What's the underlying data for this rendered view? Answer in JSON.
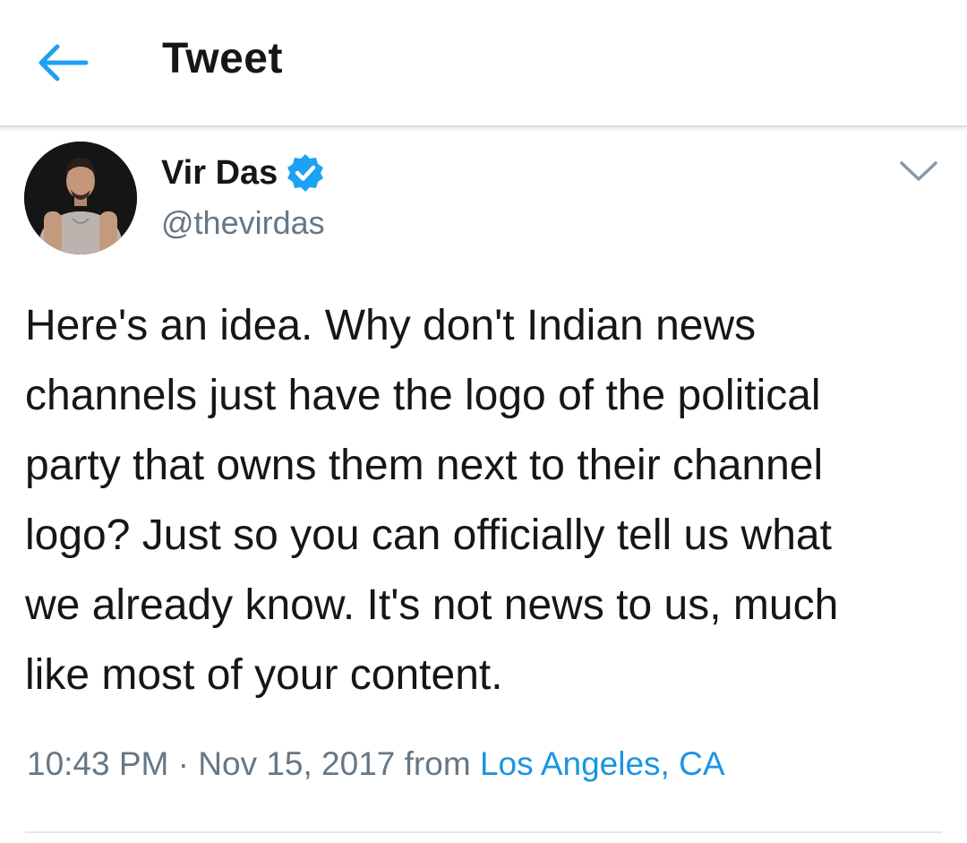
{
  "header": {
    "title": "Tweet",
    "back_icon": "arrow-left-icon"
  },
  "author": {
    "display_name": "Vir Das",
    "handle": "@thevirdas",
    "verified": true,
    "verified_icon": "verified-badge-icon",
    "menu_icon": "chevron-down-icon"
  },
  "tweet": {
    "text": "Here's an idea. Why don't Indian news\nchannels just have the logo of the political\nparty that owns them next to their channel\nlogo? Just so you can officially tell us what\nwe already know. It's not news to us, much\nlike most of your content.",
    "time": "10:43 PM",
    "separator": "·",
    "date": "Nov 15, 2017",
    "from_label": "from",
    "location": "Los Angeles, CA"
  },
  "colors": {
    "accent": "#1da1f2",
    "link": "#1b95e0",
    "secondary_text": "#657786",
    "primary_text": "#14171a"
  }
}
